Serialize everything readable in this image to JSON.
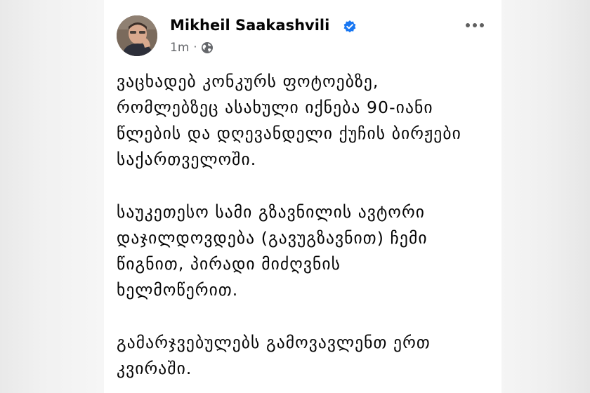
{
  "post": {
    "author": {
      "name": "Mikheil Saakashvili",
      "verified": true,
      "avatar_icon": "profile-photo"
    },
    "time": "1m",
    "separator": "·",
    "privacy_icon": "globe-icon",
    "more_icon": "more-options-icon",
    "paragraphs": [
      "ვაცხადებ კონკურს ფოტოებზე,\nრომლებზეც ასახული იქნება 90-იანი\nწლების და დღევანდელი ქუჩის ბირჟები\nსაქართველოში.",
      "საუკეთესო სამი გზავნილის ავტორი\nდაჯილდოვდება (გავუგზავნით) ჩემი\nწიგნით, პირადი მიძღვნის\nხელმოწერით.",
      "გამარჯვებულებს გამოვავლენთ ერთ\nკვირაში."
    ]
  },
  "colors": {
    "text": "#050505",
    "meta": "#65676b",
    "verified": "#1877f2",
    "card": "#ffffff",
    "background": "#f3f3f3"
  }
}
